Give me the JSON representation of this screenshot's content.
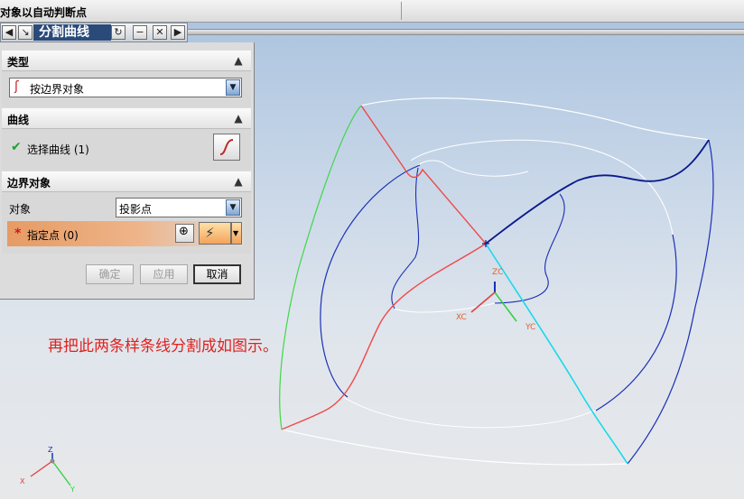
{
  "topbar": {
    "title": "对象以自动判断点"
  },
  "dialog": {
    "title": "分割曲线",
    "sections": {
      "type": {
        "header": "类型",
        "select_value": "按边界对象"
      },
      "curve": {
        "header": "曲线",
        "select_curve_label": "选择曲线 (1)"
      },
      "boundary": {
        "header": "边界对象",
        "object_label": "对象",
        "object_value": "投影点",
        "specify_point_label": "指定点 (0)"
      }
    },
    "buttons": {
      "ok": "确定",
      "apply": "应用",
      "cancel": "取消"
    }
  },
  "annotation": "再把此两条样条线分割成如图示。",
  "triad_center": {
    "zc": "ZC",
    "xc": "XC",
    "yc": "YC"
  },
  "triad_corner": {
    "z": "Z",
    "x": "X",
    "y": "Y"
  },
  "colors": {
    "dialog_title_bg": "#2a4a7a",
    "curve_red": "#ee4a4a",
    "curve_blue": "#1b2fb6",
    "curve_dark_blue": "#0a1a8c",
    "curve_cyan": "#19d9ea",
    "curve_green": "#3fd74a",
    "curve_white": "#ffffff",
    "annotation": "#e0221f",
    "required_asterisk": "#d9151b"
  }
}
